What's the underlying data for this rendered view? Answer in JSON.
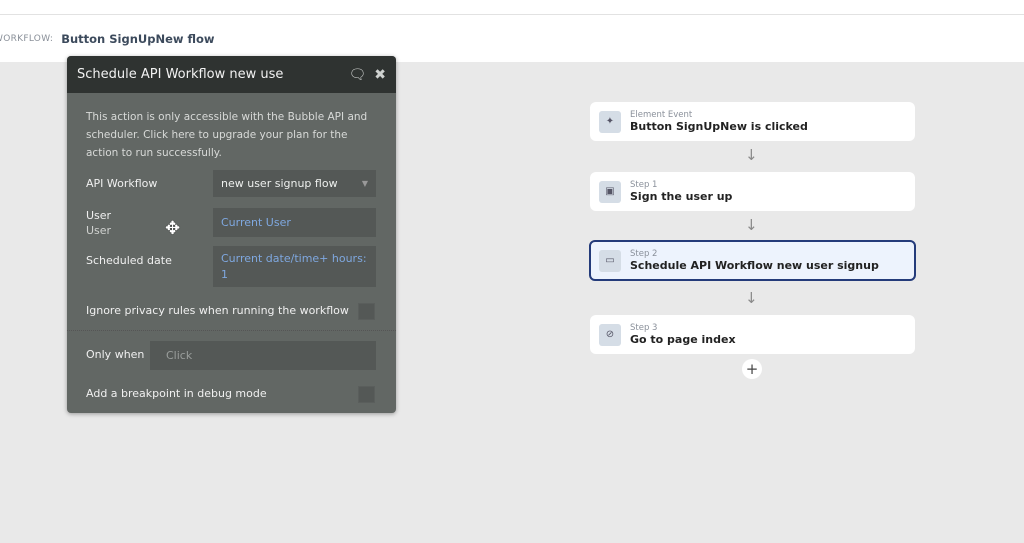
{
  "breadcrumb": {
    "label": "WORKFLOW:",
    "name": "Button SignUpNew flow"
  },
  "panel": {
    "title": "Schedule API Workflow new use",
    "note": "This action is only accessible with the Bubble API and scheduler. Click here to upgrade your plan for the action to run successfully.",
    "api_workflow": {
      "label": "API Workflow",
      "value": "new user signup flow"
    },
    "user": {
      "label": "User",
      "sublabel": "User",
      "value": "Current User"
    },
    "scheduled_date": {
      "label": "Scheduled date",
      "value": "Current date/time+ hours: 1"
    },
    "ignore_privacy": {
      "label": "Ignore privacy rules when running the workflow",
      "checked": false
    },
    "only_when": {
      "label": "Only when",
      "placeholder": "Click"
    },
    "breakpoint": {
      "label": "Add a breakpoint in debug mode",
      "checked": false
    }
  },
  "steps": [
    {
      "sub": "Element Event",
      "title": "Button SignUpNew is clicked",
      "icon": "cursor-click-icon"
    },
    {
      "sub": "Step 1",
      "title": "Sign the user up",
      "icon": "user-card-icon"
    },
    {
      "sub": "Step 2",
      "title": "Schedule API Workflow new user signup",
      "icon": "rectangle-icon",
      "selected": true
    },
    {
      "sub": "Step 3",
      "title": "Go to page index",
      "icon": "compass-icon"
    }
  ],
  "colors": {
    "accent": "#243b7a",
    "panel": "#626764",
    "panel_header": "#2f3331"
  }
}
